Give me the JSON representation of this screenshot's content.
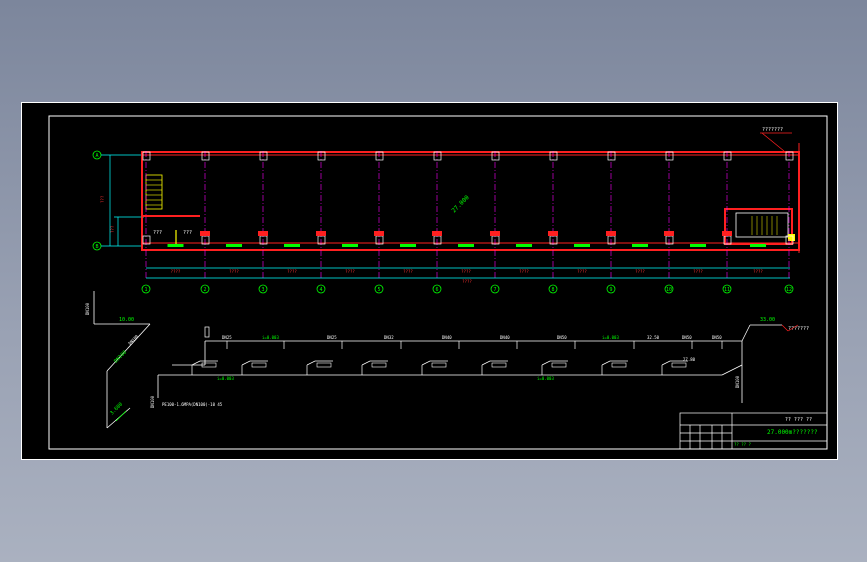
{
  "viewer": {
    "name": "CAD drawing viewer"
  },
  "colors": {
    "wall": "#ff2020",
    "axis": "#00ffff",
    "grid_line": "#ff00ff",
    "pipe": "#ffffff",
    "text_green": "#00ff00",
    "text_yellow": "#ffff00",
    "text_red": "#ff3030"
  },
  "plan": {
    "left_axes": [
      "A",
      "B"
    ],
    "bottom_axes": [
      "1",
      "2",
      "3",
      "4",
      "5",
      "6",
      "7",
      "8",
      "9",
      "10",
      "11",
      "12"
    ],
    "room_labels": [
      "???",
      "???"
    ],
    "center_label": "27.000",
    "top_right_label": "???????",
    "bottom_total_dim": "????",
    "span_dims": [
      "????",
      "????",
      "????",
      "????",
      "????",
      "????",
      "????",
      "????",
      "????",
      "????",
      "????"
    ],
    "left_dims": [
      "???",
      "???"
    ]
  },
  "isometric": {
    "left_labels": [
      "DN100",
      "DN100",
      "10.00",
      "DN100",
      "3.600"
    ],
    "pipe_note": "PE100-1.6MPA(DN100)-10 45",
    "upper_sizes": [
      "DN25",
      "DN25",
      "DN32",
      "DN40",
      "DN40",
      "DN50",
      "DN50",
      "DN50"
    ],
    "upper_slopes": [
      "i=0.003",
      "i=0.003",
      "i=0.003"
    ],
    "lower_slopes": [
      "i=0.003",
      "i=0.003"
    ],
    "elevations": [
      "32.50",
      "27.80",
      "33.00"
    ],
    "right_label": "???????",
    "right_dn": "DN100"
  },
  "title_block": {
    "top_right": "?? ??? ??",
    "main_text": "27.000m???????",
    "footer": "?? ?? ?"
  }
}
